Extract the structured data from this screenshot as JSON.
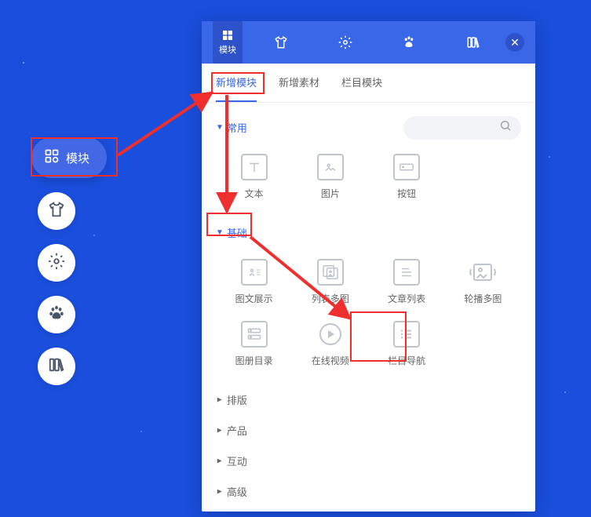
{
  "sideNav": {
    "main": {
      "label": "模块"
    }
  },
  "panelHeader": {
    "activeTab": "模块"
  },
  "subTabs": [
    "新增模块",
    "新增素材",
    "栏目模块"
  ],
  "sections": {
    "common": {
      "label": "常用",
      "items": [
        {
          "label": "文本"
        },
        {
          "label": "图片"
        },
        {
          "label": "按钮"
        }
      ]
    },
    "basics": {
      "label": "基础",
      "items": [
        {
          "label": "图文展示"
        },
        {
          "label": "列表多图"
        },
        {
          "label": "文章列表"
        },
        {
          "label": "轮播多图"
        },
        {
          "label": "图册目录"
        },
        {
          "label": "在线视频"
        },
        {
          "label": "栏目导航"
        }
      ]
    },
    "collapsed": [
      "排版",
      "产品",
      "互动",
      "高级"
    ]
  }
}
